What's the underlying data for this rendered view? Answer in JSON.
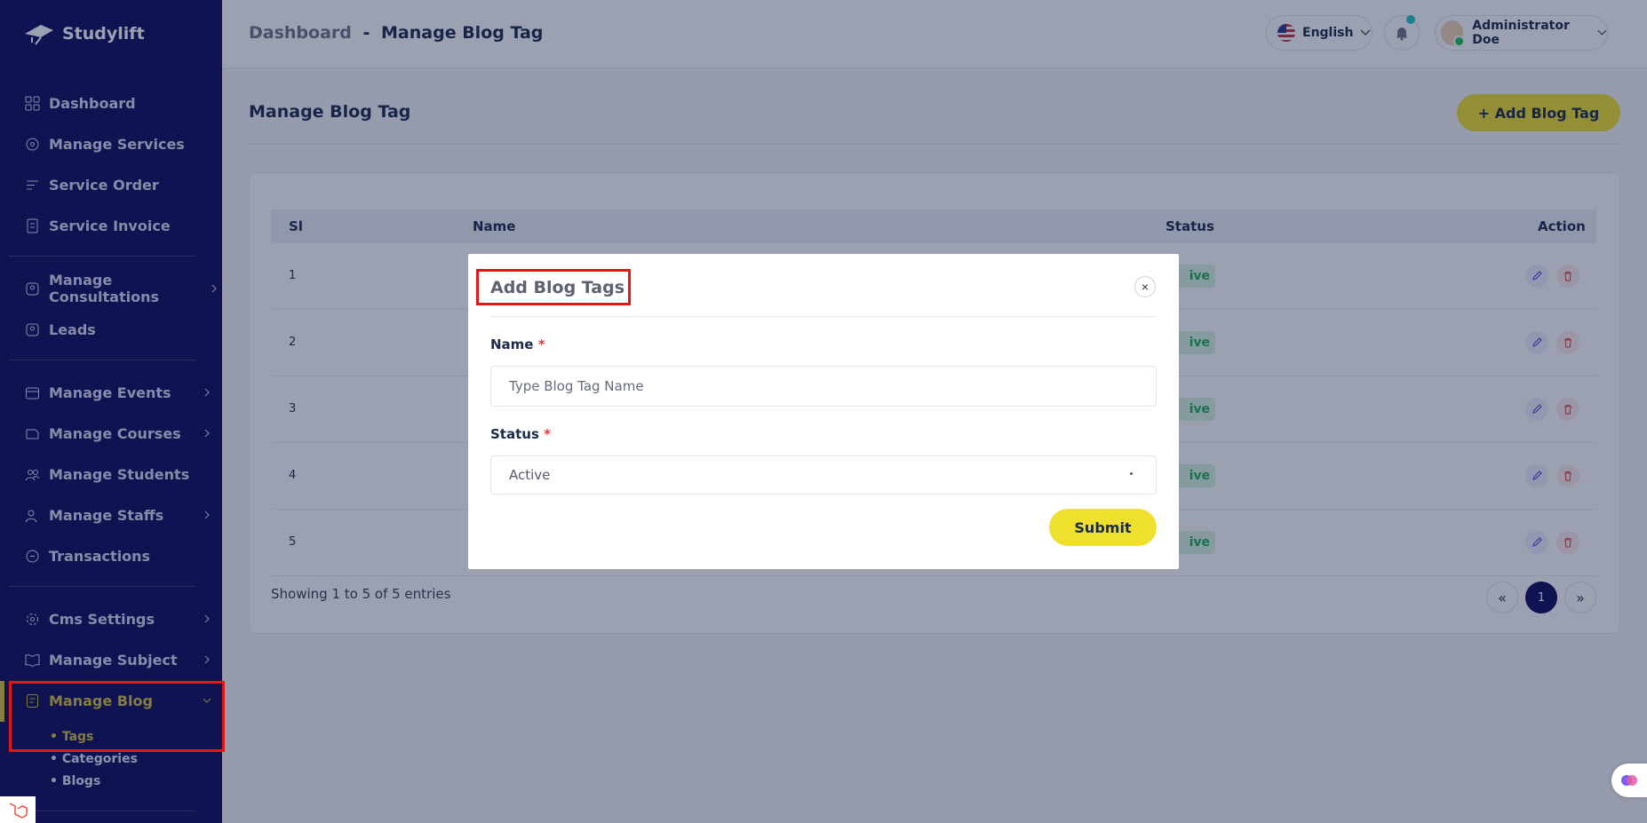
{
  "brand": {
    "name": "Studylift"
  },
  "sidebar": {
    "items": [
      {
        "label": "Dashboard",
        "icon": "dashboard-icon"
      },
      {
        "label": "Manage Services",
        "icon": "services-icon"
      },
      {
        "label": "Service Order",
        "icon": "order-icon"
      },
      {
        "label": "Service Invoice",
        "icon": "invoice-icon"
      },
      {
        "label": "Manage Consultations",
        "icon": "consultation-icon"
      },
      {
        "label": "Leads",
        "icon": "leads-icon"
      },
      {
        "label": "Manage Events",
        "icon": "calendar-icon"
      },
      {
        "label": "Manage Courses",
        "icon": "courses-icon"
      },
      {
        "label": "Manage Students",
        "icon": "students-icon"
      },
      {
        "label": "Manage Staffs",
        "icon": "staffs-icon"
      },
      {
        "label": "Transactions",
        "icon": "transactions-icon"
      },
      {
        "label": "Cms Settings",
        "icon": "settings-icon"
      },
      {
        "label": "Manage Subject",
        "icon": "book-icon"
      },
      {
        "label": "Manage Blog",
        "icon": "blog-icon"
      }
    ],
    "blog_sub": [
      "Tags",
      "Categories",
      "Blogs"
    ]
  },
  "header": {
    "crumb_parent": "Dashboard",
    "crumb_sep": "-",
    "crumb_current": "Manage Blog Tag",
    "language": "English",
    "user_name": "Administrator Doe"
  },
  "main": {
    "title": "Manage Blog Tag",
    "add_button": "+ Add Blog Tag",
    "columns": {
      "sl": "Sl",
      "name": "Name",
      "status": "Status",
      "action": "Action"
    },
    "rows": [
      {
        "sl": "1",
        "status": "ive"
      },
      {
        "sl": "2",
        "status": "ive"
      },
      {
        "sl": "3",
        "status": "ive"
      },
      {
        "sl": "4",
        "status": "ive"
      },
      {
        "sl": "5",
        "status": "ive"
      }
    ],
    "entries": "Showing 1 to 5 of 5 entries",
    "pagination": {
      "prev": "«",
      "current": "1",
      "next": "»"
    }
  },
  "modal": {
    "title": "Add Blog Tags",
    "close": "×",
    "name_label": "Name",
    "required": "*",
    "name_placeholder": "Type Blog Tag Name",
    "status_label": "Status",
    "status_value": "Active",
    "submit": "Submit"
  },
  "colors": {
    "sidebar": "#0d0b5c",
    "accent": "#efe02e",
    "active": "#d7c23a",
    "highlight": "#e11616"
  }
}
